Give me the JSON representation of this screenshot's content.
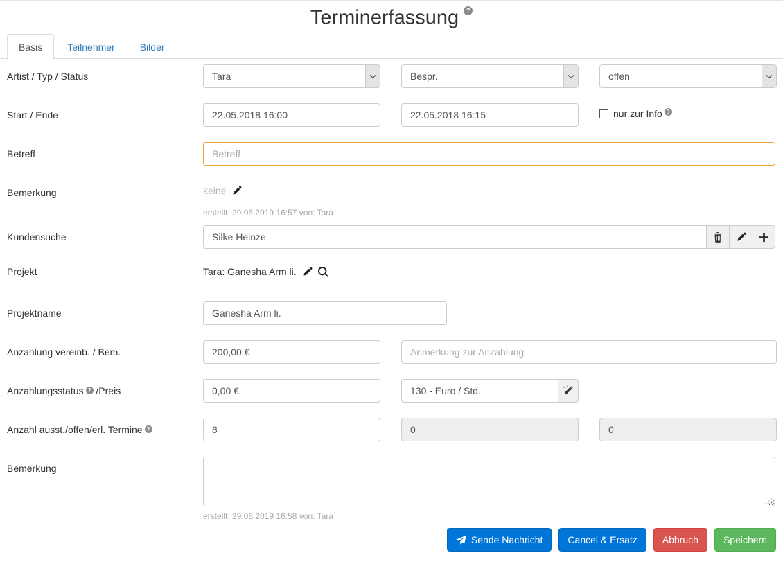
{
  "header": {
    "title": "Terminerfassung",
    "help_icon": "help-circle-icon",
    "help_glyph": "?"
  },
  "tabs": [
    {
      "label": "Basis",
      "active": true
    },
    {
      "label": "Teilnehmer",
      "active": false
    },
    {
      "label": "Bilder",
      "active": false
    }
  ],
  "form": {
    "artist_row": {
      "label": "Artist / Typ / Status",
      "artist_value": "Tara",
      "typ_value": "Bespr.",
      "status_value": "offen"
    },
    "start_end_row": {
      "label": "Start / Ende",
      "start_value": "22.05.2018 16:00",
      "end_value": "22.05.2018 16:15",
      "info_checkbox_label": "nur zur Info",
      "info_checkbox_checked": false
    },
    "betreff_row": {
      "label": "Betreff",
      "value": "",
      "placeholder": "Betreff"
    },
    "bemerkung_row": {
      "label": "Bemerkung",
      "value": "keine",
      "edit_icon": "pencil-icon",
      "meta": "erstellt: 29.06.2019 16:57 von: Tara"
    },
    "kundensuche_row": {
      "label": "Kundensuche",
      "value": "Silke Heinze",
      "buttons": [
        {
          "name": "delete-customer-button",
          "icon": "trash-icon"
        },
        {
          "name": "edit-customer-button",
          "icon": "pencil-icon"
        },
        {
          "name": "add-customer-button",
          "icon": "plus-icon"
        }
      ]
    },
    "projekt_row": {
      "label": "Projekt",
      "value": "Tara: Ganesha Arm li.",
      "edit_icon": "pencil-icon",
      "search_icon": "search-icon"
    },
    "projektname_row": {
      "label": "Projektname",
      "value": "Ganesha Arm li."
    },
    "anzahlung_row": {
      "label": "Anzahlung vereinb. / Bem.",
      "amount_value": "200,00 €",
      "note_value": "",
      "note_placeholder": "Anmerkung zur Anzahlung"
    },
    "anzahlungsstatus_row": {
      "label_before": "Anzahlungsstatus",
      "label_after": "/Preis",
      "status_value": "0,00 €",
      "preis_value": "130,- Euro / Std.",
      "wand_button_icon": "magic-wand-icon"
    },
    "termine_row": {
      "label": "Anzahl ausst./offen/erl. Termine",
      "ausstehend_value": "8",
      "offen_value": "0",
      "erledigt_value": "0"
    },
    "bemerkung2_row": {
      "label": "Bemerkung",
      "value": "",
      "meta": "erstellt: 29.06.2019 16:58 von: Tara"
    }
  },
  "footer": {
    "buttons": [
      {
        "label": "Sende Nachricht",
        "style": "primary",
        "icon": "paper-plane-icon",
        "name": "send-message-button"
      },
      {
        "label": "Cancel & Ersatz",
        "style": "primary",
        "icon": "",
        "name": "cancel-and-replace-button"
      },
      {
        "label": "Abbruch",
        "style": "danger",
        "icon": "",
        "name": "abort-button"
      },
      {
        "label": "Speichern",
        "style": "success",
        "icon": "",
        "name": "save-button"
      }
    ]
  },
  "colors": {
    "primary": "#0275d8",
    "danger": "#d9534f",
    "success": "#5cb85c",
    "link": "#337ab7",
    "warn_border": "#e8a33d",
    "muted": "#a8a8a8"
  }
}
